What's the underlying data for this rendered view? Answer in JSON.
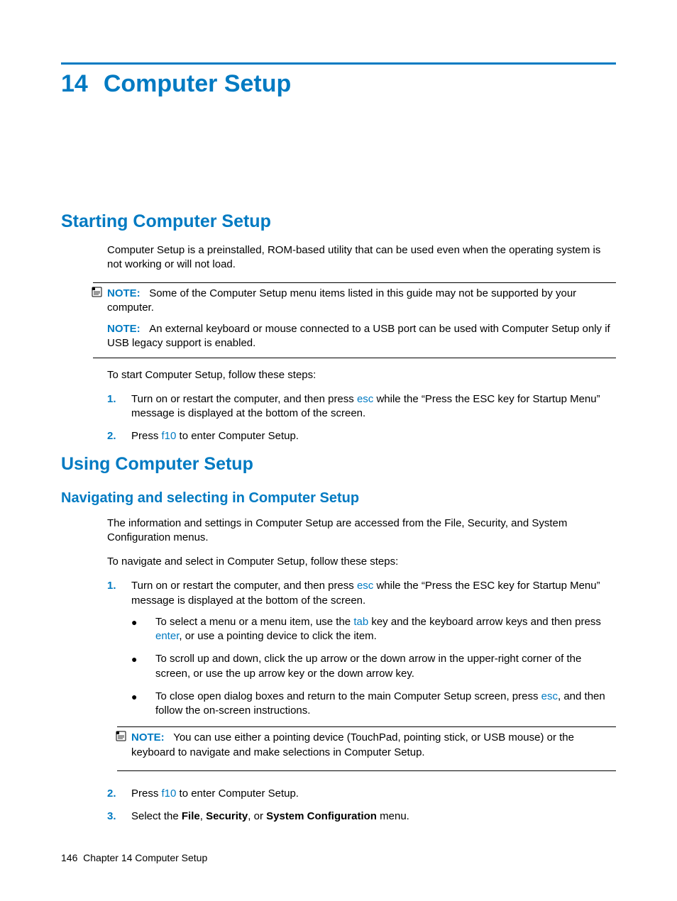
{
  "chapter": {
    "number": "14",
    "title": "Computer Setup"
  },
  "section1": {
    "heading": "Starting Computer Setup",
    "intro": "Computer Setup is a preinstalled, ROM-based utility that can be used even when the operating system is not working or will not load.",
    "note1_label": "NOTE:",
    "note1_text": "Some of the Computer Setup menu items listed in this guide may not be supported by your computer.",
    "note2_label": "NOTE:",
    "note2_text": "An external keyboard or mouse connected to a USB port can be used with Computer Setup only if USB legacy support is enabled.",
    "lead": "To start Computer Setup, follow these steps:",
    "step1_num": "1.",
    "step1_a": "Turn on or restart the computer, and then press ",
    "step1_key": "esc",
    "step1_b": " while the “Press the ESC key for Startup Menu” message is displayed at the bottom of the screen.",
    "step2_num": "2.",
    "step2_a": "Press ",
    "step2_key": "f10",
    "step2_b": " to enter Computer Setup."
  },
  "section2": {
    "heading": "Using Computer Setup",
    "sub": {
      "heading": "Navigating and selecting in Computer Setup",
      "para1": "The information and settings in Computer Setup are accessed from the File, Security, and System Configuration menus.",
      "lead": "To navigate and select in Computer Setup, follow these steps:",
      "s1_num": "1.",
      "s1_a": "Turn on or restart the computer, and then press ",
      "s1_key": "esc",
      "s1_b": " while the “Press the ESC key for Startup Menu” message is displayed at the bottom of the screen.",
      "b1_a": "To select a menu or a menu item, use the ",
      "b1_key1": "tab",
      "b1_b": " key and the keyboard arrow keys and then press ",
      "b1_key2": "enter",
      "b1_c": ", or use a pointing device to click the item.",
      "b2": "To scroll up and down, click the up arrow or the down arrow in the upper-right corner of the screen, or use the up arrow key or the down arrow key.",
      "b3_a": "To close open dialog boxes and return to the main Computer Setup screen, press ",
      "b3_key": "esc",
      "b3_b": ", and then follow the on-screen instructions.",
      "note_label": "NOTE:",
      "note_text": "You can use either a pointing device (TouchPad, pointing stick, or USB mouse) or the keyboard to navigate and make selections in Computer Setup.",
      "s2_num": "2.",
      "s2_a": "Press ",
      "s2_key": "f10",
      "s2_b": " to enter Computer Setup.",
      "s3_num": "3.",
      "s3_a": "Select the ",
      "s3_bold1": "File",
      "s3_b": ", ",
      "s3_bold2": "Security",
      "s3_c": ", or ",
      "s3_bold3": "System Configuration",
      "s3_d": " menu."
    }
  },
  "footer": {
    "page": "146",
    "label": "Chapter 14   Computer Setup"
  }
}
